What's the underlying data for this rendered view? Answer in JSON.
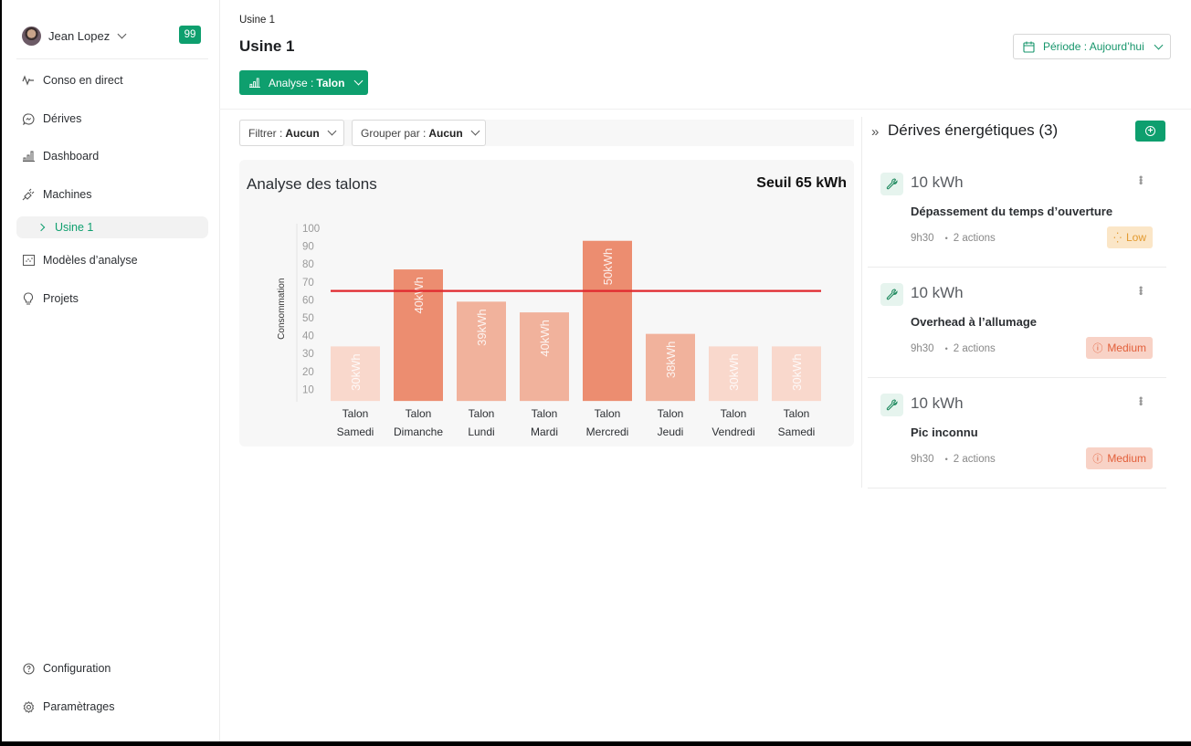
{
  "user": {
    "name": "Jean Lopez",
    "notifications": "99"
  },
  "sidebar": {
    "items": [
      {
        "label": "Conso en direct",
        "icon": "activity-icon"
      },
      {
        "label": "Dérives",
        "icon": "chat-wave-icon"
      },
      {
        "label": "Dashboard",
        "icon": "bar-chart-icon"
      },
      {
        "label": "Machines",
        "icon": "plug-icon"
      },
      {
        "label": "Modèles d’analyse",
        "icon": "scatter-chart-icon"
      },
      {
        "label": "Projets",
        "icon": "lightbulb-icon"
      }
    ],
    "sub_item": "Usine 1",
    "bottom": [
      {
        "label": "Configuration",
        "icon": "help-circle-icon"
      },
      {
        "label": "Paramètrages",
        "icon": "gear-icon"
      }
    ]
  },
  "header": {
    "breadcrumb": "Usine 1",
    "title": "Usine 1",
    "analyse_prefix": "Analyse :",
    "analyse_value": "Talon",
    "period_label": "Période : Aujourd’hui"
  },
  "filters": {
    "filter_prefix": "Filtrer :",
    "filter_value": "Aucun",
    "group_prefix": "Grouper par :",
    "group_value": "Aucun"
  },
  "chart_card": {
    "title": "Analyse des talons",
    "threshold_label": "Seuil 65 kWh"
  },
  "chart_data": {
    "type": "bar",
    "title": "Analyse des talons",
    "ylabel": "Consommation",
    "xlabel": "",
    "ylim": [
      0,
      100
    ],
    "yticks": [
      10,
      20,
      30,
      40,
      50,
      60,
      70,
      80,
      90,
      100
    ],
    "categories": [
      [
        "Talon",
        "Samedi"
      ],
      [
        "Talon",
        "Dimanche"
      ],
      [
        "Talon",
        "Lundi"
      ],
      [
        "Talon",
        "Mardi"
      ],
      [
        "Talon",
        "Mercredi"
      ],
      [
        "Talon",
        "Jeudi"
      ],
      [
        "Talon",
        "Vendredi"
      ],
      [
        "Talon",
        "Samedi"
      ]
    ],
    "values": [
      34,
      77,
      59,
      53,
      93,
      41,
      34,
      34
    ],
    "data_labels": [
      "30kWh",
      "40kWh",
      "39kWh",
      "40kWh",
      "50kWh",
      "38kWh",
      "30kWh",
      "30kWh"
    ],
    "bar_colors": [
      "#f9d8cc",
      "#ec8d70",
      "#f1b29c",
      "#f1b29c",
      "#ec8d70",
      "#f1b29c",
      "#f9d8cc",
      "#f9d8cc"
    ],
    "threshold": {
      "value": 65,
      "label": "Seuil 65 kWh",
      "color": "#e0282e"
    },
    "grid": false,
    "legend": "none"
  },
  "drifts_panel": {
    "title": "Dérives énergétiques (3)",
    "items": [
      {
        "value": "10 kWh",
        "name": "Dépassement du temps d’ouverture",
        "time": "9h30",
        "actions": "2 actions",
        "severity": "Low",
        "severity_level": "low"
      },
      {
        "value": "10 kWh",
        "name": "Overhead à l’allumage",
        "time": "9h30",
        "actions": "2 actions",
        "severity": "Medium",
        "severity_level": "med"
      },
      {
        "value": "10 kWh",
        "name": "Pic inconnu",
        "time": "9h30",
        "actions": "2 actions",
        "severity": "Medium",
        "severity_level": "med"
      }
    ]
  },
  "colors": {
    "brand": "#0e9f6e",
    "threshold": "#e0282e",
    "low_bg": "#fbe6c7",
    "low_fg": "#e39a2f",
    "medium_bg": "#f8d2c6",
    "medium_fg": "#e25f3a"
  }
}
